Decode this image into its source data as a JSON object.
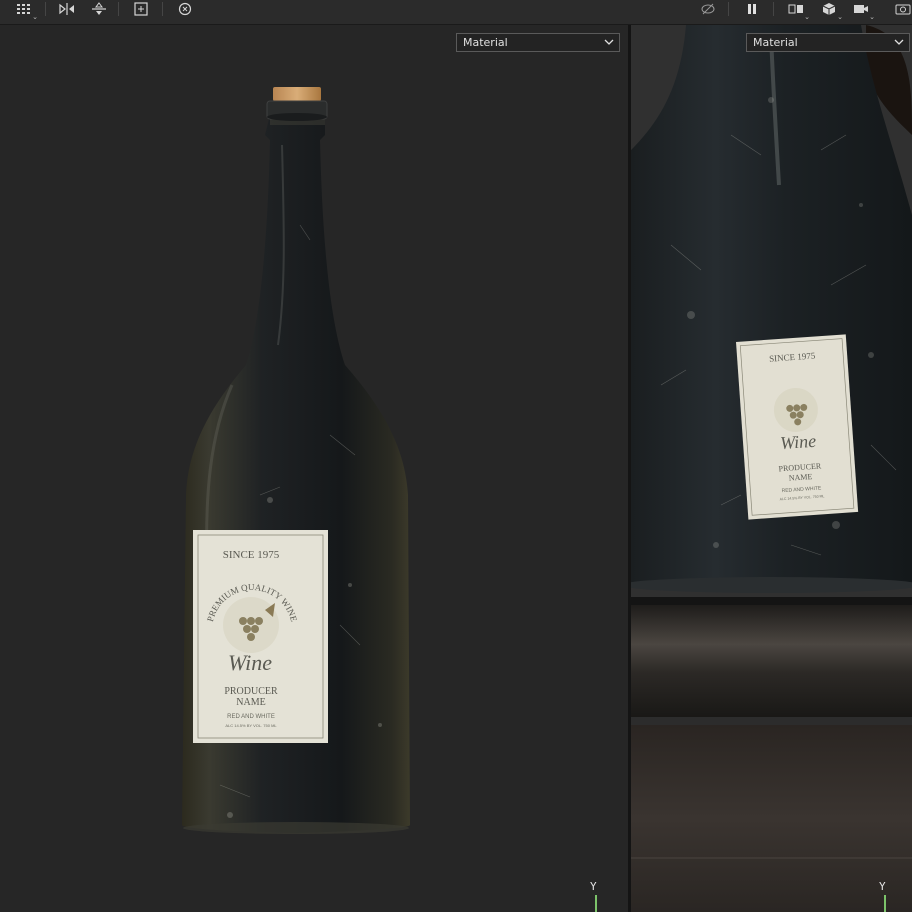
{
  "toolbar": {
    "icons": [
      "grid-menu-icon",
      "mirror-icon",
      "align-icon",
      "add-frame-icon",
      "reset-view-icon",
      "hide-icon",
      "pause-icon",
      "split-view-icon",
      "cube-icon",
      "camera-icon",
      "screenshot-icon"
    ]
  },
  "viewport_left": {
    "mode_value": "Material",
    "axis_label": "Y"
  },
  "viewport_right": {
    "mode_value": "Material",
    "axis_label": "Y"
  },
  "label": {
    "since": "SINCE 1975",
    "arc": "PREMIUM QUALITY WINE",
    "script": "Wine",
    "producer": "PRODUCER",
    "name": "NAME",
    "sub": "RED AND WHITE",
    "fine": "ALC 14.5% BY VOL. 750 ML"
  },
  "colors": {
    "accent_axis": "#7cc36a",
    "viewport_bg": "#262626",
    "glass": "#1f2326",
    "label_paper": "#e4e2d6",
    "cork": "#c99a63"
  }
}
